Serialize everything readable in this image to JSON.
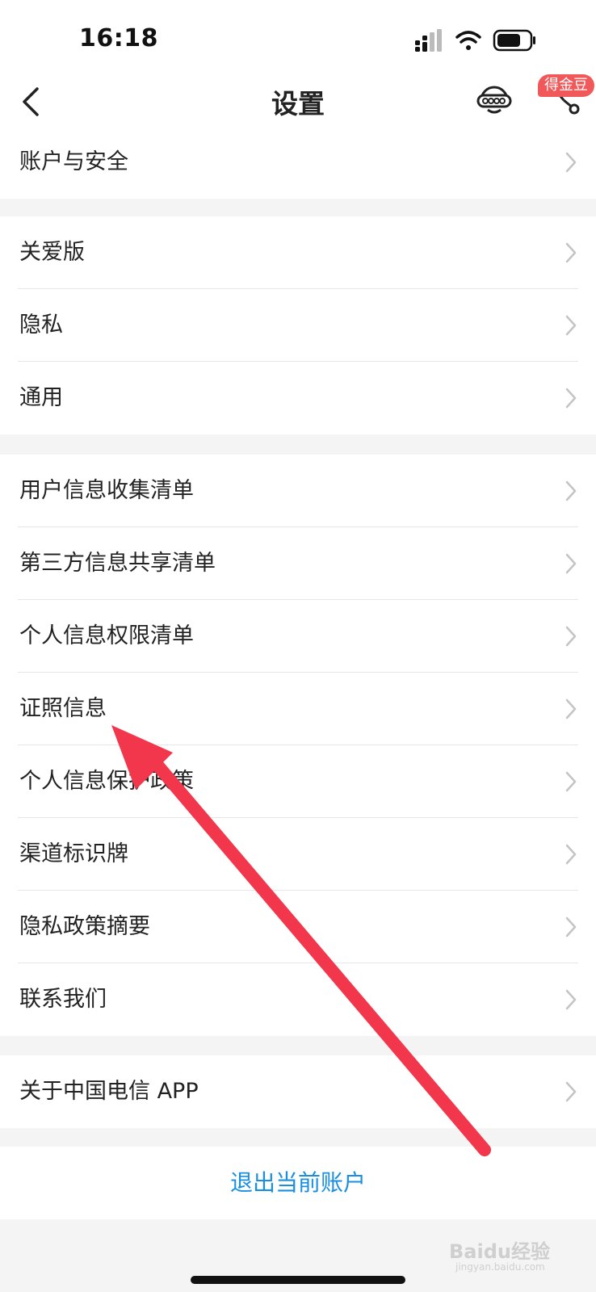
{
  "status": {
    "time": "16:18"
  },
  "nav": {
    "title": "设置",
    "badge": "得金豆"
  },
  "groups": [
    {
      "items": [
        {
          "label": "账户与安全"
        }
      ]
    },
    {
      "items": [
        {
          "label": "关爱版"
        },
        {
          "label": "隐私"
        },
        {
          "label": "通用"
        }
      ]
    },
    {
      "items": [
        {
          "label": "用户信息收集清单"
        },
        {
          "label": "第三方信息共享清单"
        },
        {
          "label": "个人信息权限清单"
        },
        {
          "label": "证照信息"
        },
        {
          "label": "个人信息保护政策"
        },
        {
          "label": "渠道标识牌"
        },
        {
          "label": "隐私政策摘要"
        },
        {
          "label": "联系我们"
        }
      ]
    },
    {
      "items": [
        {
          "label": "关于中国电信 APP"
        }
      ]
    }
  ],
  "logout": {
    "label": "退出当前账户"
  },
  "watermark": {
    "text": "Baidu经验",
    "sub": "jingyan.baidu.com"
  },
  "colors": {
    "accent": "#1a8fe0",
    "badge": "#f0585a",
    "arrow": "#f2364b"
  }
}
